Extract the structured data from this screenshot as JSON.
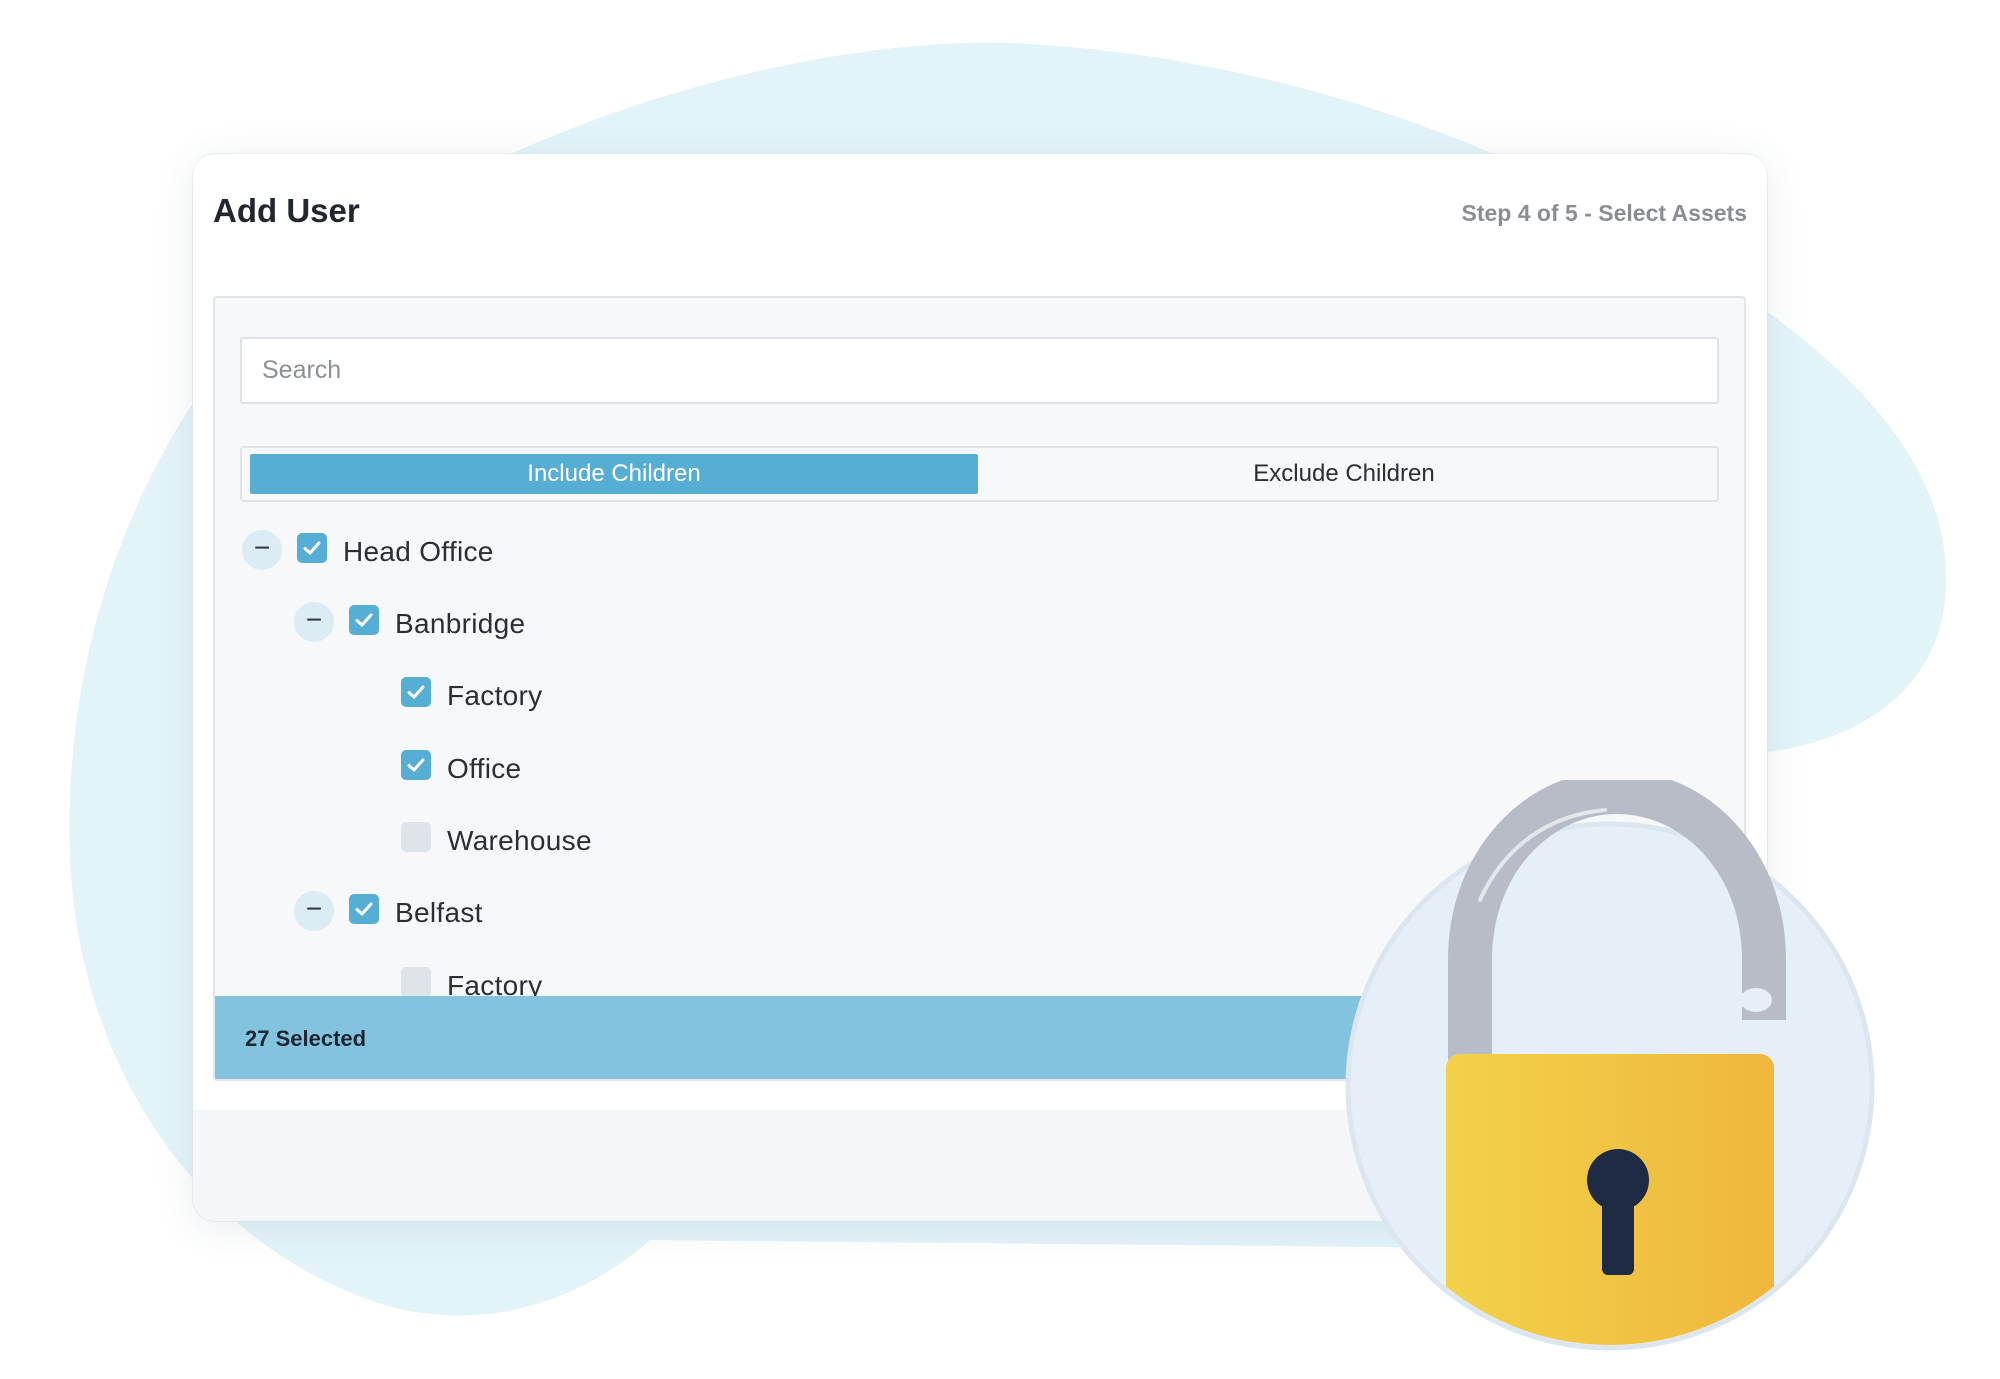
{
  "dialog": {
    "title": "Add User",
    "step": "Step 4 of 5 - Select Assets"
  },
  "search": {
    "placeholder": "Search"
  },
  "children_mode": {
    "options": [
      "Include Children",
      "Exclude Children"
    ],
    "selected": "Include Children"
  },
  "tree": [
    {
      "label": "Head Office",
      "checked": true,
      "expandable": true,
      "toggle": "−"
    },
    {
      "label": "Banbridge",
      "checked": true,
      "expandable": true,
      "toggle": "−"
    },
    {
      "label": "Factory",
      "checked": true,
      "expandable": false
    },
    {
      "label": "Office",
      "checked": true,
      "expandable": false
    },
    {
      "label": "Warehouse",
      "checked": false,
      "expandable": false
    },
    {
      "label": "Belfast",
      "checked": true,
      "expandable": true,
      "toggle": "−"
    },
    {
      "label": "Factory",
      "checked": false,
      "expandable": false
    }
  ],
  "status": {
    "selected_text": "27 Selected"
  },
  "colors": {
    "accent": "#57aed4",
    "status_bar": "#82c4df",
    "lock_body": "#f2c23e",
    "lock_shackle": "#b8bcc6",
    "keyhole": "#1f2a44"
  },
  "icons": [
    "checkmark-icon",
    "collapse-icon",
    "padlock-icon"
  ]
}
